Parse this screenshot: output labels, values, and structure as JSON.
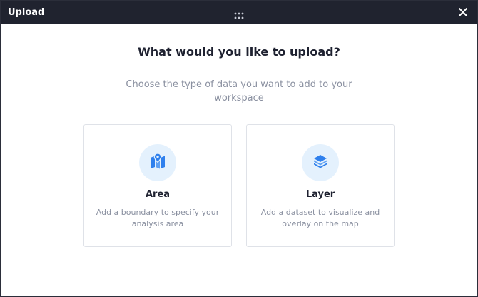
{
  "window": {
    "title": "Upload"
  },
  "dialog": {
    "heading": "What would you like to upload?",
    "subheading": "Choose the type of data you want to add to your workspace"
  },
  "options": [
    {
      "title": "Area",
      "description": "Add a boundary to specify your analysis area",
      "icon": "map-pin-icon"
    },
    {
      "title": "Layer",
      "description": "Add a dataset to visualize and overlay on the map",
      "icon": "layers-icon"
    }
  ],
  "colors": {
    "titlebar_bg": "#20232f",
    "accent": "#2f80ed",
    "icon_bg": "#e4f1fd",
    "heading_text": "#1e2130",
    "muted_text": "#8a90a0",
    "card_border": "#dfe2e8"
  }
}
